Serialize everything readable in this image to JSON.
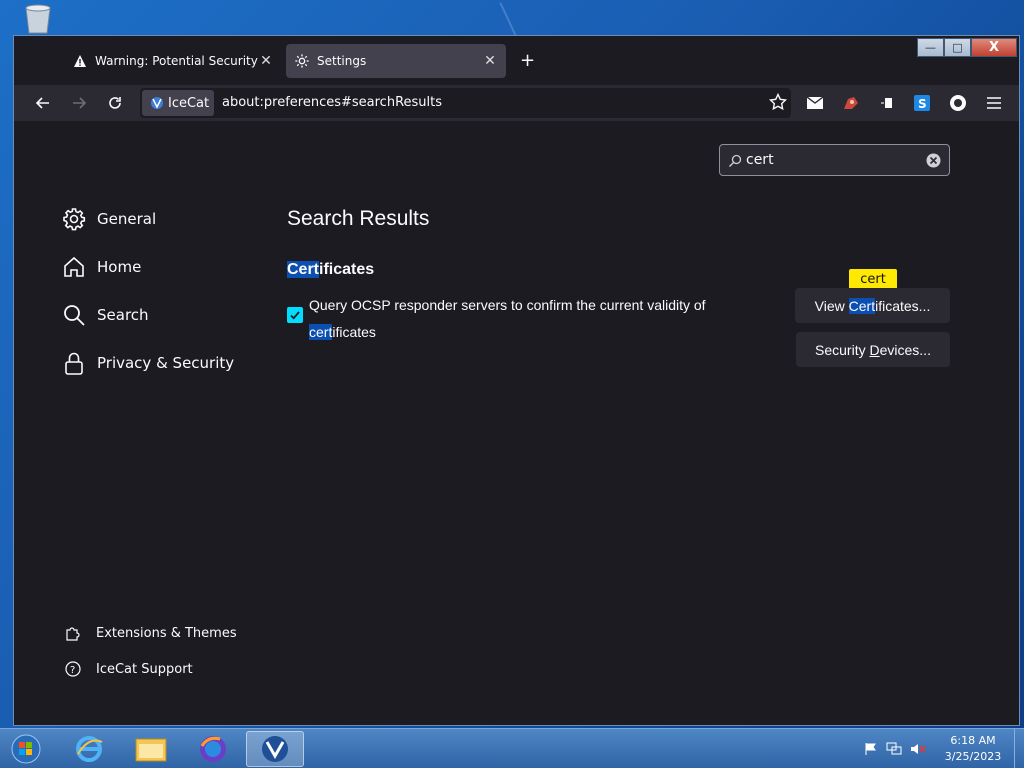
{
  "tabs": [
    {
      "title": "Warning: Potential Security Risk Ahead",
      "icon": "warning-icon"
    },
    {
      "title": "Settings",
      "icon": "gear-icon",
      "active": true
    }
  ],
  "window_buttons": {
    "minimize": "—",
    "maximize": "□",
    "close": "X"
  },
  "navbar": {
    "identity_label": "IceCat",
    "url": "about:preferences#searchResults"
  },
  "search": {
    "value": "cert"
  },
  "categories": [
    {
      "label": "General",
      "icon": "gear-icon"
    },
    {
      "label": "Home",
      "icon": "home-icon"
    },
    {
      "label": "Search",
      "icon": "search-icon"
    },
    {
      "label": "Privacy & Security",
      "icon": "lock-icon"
    }
  ],
  "footer": {
    "extensions": "Extensions & Themes",
    "support": "IceCat Support"
  },
  "main": {
    "heading": "Search Results",
    "section_hl": "Cert",
    "section_rest": "ificates",
    "checkbox_text_1": "Query OCSP responder servers to confirm the current validity of ",
    "checkbox_hl": "cert",
    "checkbox_text_2": "ificates",
    "checkbox_checked": true,
    "view_btn_pre": "View ",
    "view_btn_hl": "Cert",
    "view_btn_post": "ificates...",
    "tooltip": "cert",
    "devices_btn_pre": "Security ",
    "devices_btn_u": "D",
    "devices_btn_post": "evices..."
  },
  "taskbar": {
    "time": "6:18 AM",
    "date": "3/25/2023"
  },
  "colors": {
    "accent": "#00ddff",
    "highlight": "#0b4fb0",
    "tooltip": "#ffe900",
    "background": "#1c1b22"
  }
}
